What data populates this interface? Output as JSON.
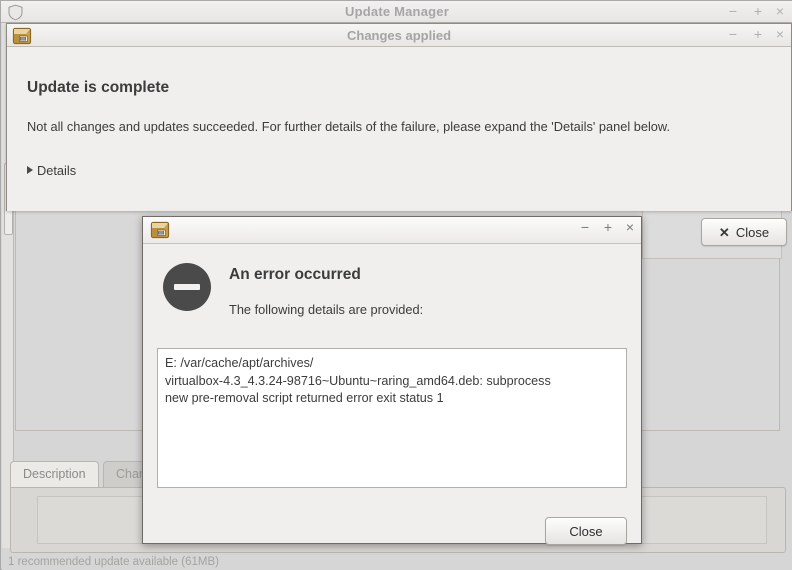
{
  "main_window": {
    "title": "Update Manager",
    "icon": "shield-icon",
    "controls": {
      "minimize": "−",
      "maximize": "+",
      "close": "×"
    },
    "tabs": [
      {
        "label": "Description",
        "active": true
      },
      {
        "label": "Chang",
        "active": false
      }
    ],
    "statusbar": "1 recommended update available (61MB)"
  },
  "changes_dialog": {
    "title": "Changes applied",
    "icon": "package-icon",
    "controls": {
      "minimize": "−",
      "maximize": "+",
      "close": "×"
    },
    "heading": "Update is complete",
    "body": "Not all changes and updates succeeded. For further details of the failure, please expand the 'Details' panel below.",
    "details_label": "Details",
    "details_expanded": false,
    "close_button": {
      "label": "Close",
      "icon": "close-x-icon",
      "glyph": "✕"
    }
  },
  "error_dialog": {
    "title": "",
    "icon": "package-icon",
    "controls": {
      "minimize": "−",
      "maximize": "+",
      "close": "×"
    },
    "status_icon": "error-circle-icon",
    "heading": "An error occurred",
    "subheading": "The following details are provided:",
    "details_text": "E: /var/cache/apt/archives/\nvirtualbox-4.3_4.3.24-98716~Ubuntu~raring_amd64.deb: subprocess\nnew pre-removal script returned error exit status 1",
    "close_button": {
      "label": "Close"
    }
  },
  "colors": {
    "window_bg": "#f0efed",
    "desktop_bg": "#d6d6d6",
    "title_text_inactive": "#a4a4a4",
    "body_text": "#3c3c3c",
    "error_icon": "#4a4a4a",
    "package_icon": "#c8973f"
  }
}
